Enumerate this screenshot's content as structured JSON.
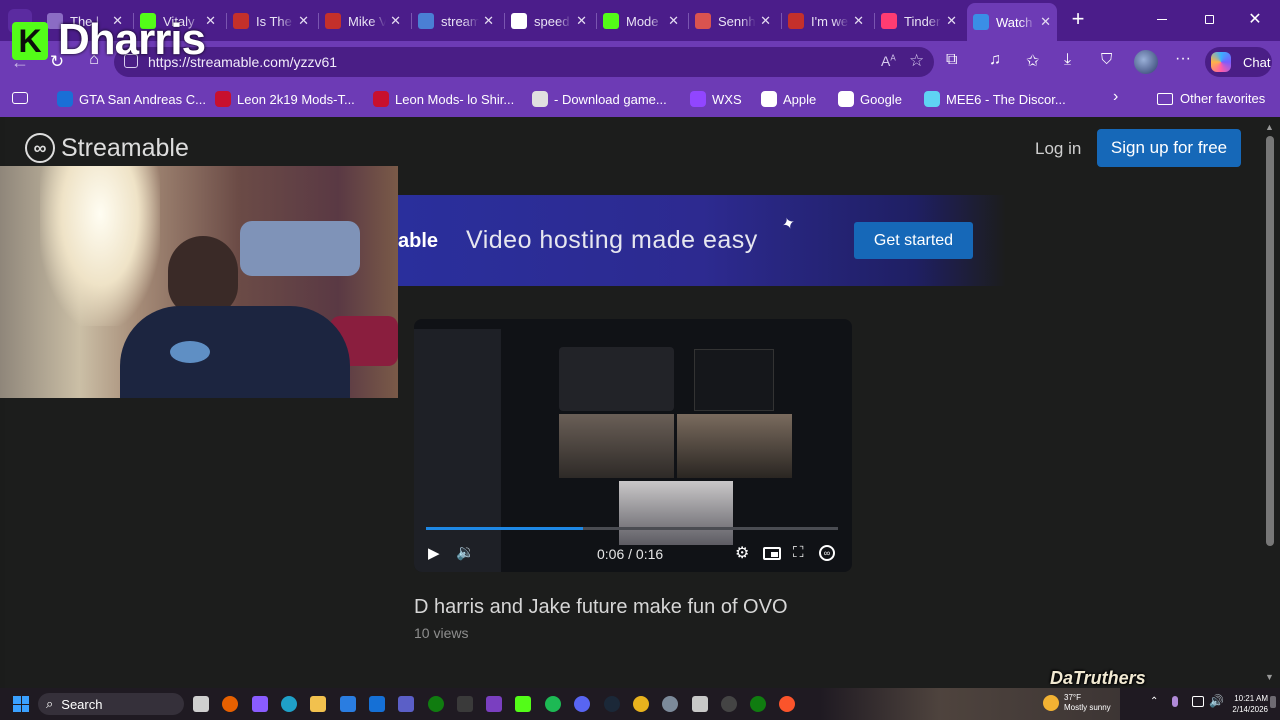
{
  "browser": {
    "tabs": [
      {
        "title": "The l",
        "icon": "globe-icon",
        "color": "#8b6cc4"
      },
      {
        "title": "Vitaly",
        "icon": "kick-icon",
        "color": "#53fc18"
      },
      {
        "title": "Is The",
        "icon": "youtube-icon",
        "color": "#c4302b"
      },
      {
        "title": "Mike V",
        "icon": "youtube-icon",
        "color": "#c4302b"
      },
      {
        "title": "stream",
        "icon": "search-icon",
        "color": "#4a7fd4"
      },
      {
        "title": "speed",
        "icon": "google-icon",
        "color": "#ffffff"
      },
      {
        "title": "Mode",
        "icon": "kick-icon",
        "color": "#53fc18"
      },
      {
        "title": "Sennh",
        "icon": "c-logo-icon",
        "color": "#d9534f"
      },
      {
        "title": "I'm we",
        "icon": "youtube-icon",
        "color": "#c4302b"
      },
      {
        "title": "Tinder",
        "icon": "tinder-icon",
        "color": "#fe3c72"
      },
      {
        "title": "Watch",
        "icon": "streamable-icon",
        "color": "#3a8ee6"
      }
    ],
    "url": "https://streamable.com/yzzv61",
    "chat_label": "Chat",
    "bookmarks": [
      {
        "label": "GTA San Andreas C...",
        "icon": "gtm-icon",
        "color": "#1a6fd6"
      },
      {
        "label": "Leon 2k19 Mods-T...",
        "icon": "leon-icon",
        "color": "#c8102e"
      },
      {
        "label": "Leon Mods- lo Shir...",
        "icon": "leon-icon",
        "color": "#c8102e"
      },
      {
        "label": "- Download game...",
        "icon": "wordpress-icon",
        "color": "#e0e0e0"
      },
      {
        "label": "WXS",
        "icon": "twitch-icon",
        "color": "#9146ff"
      },
      {
        "label": "Apple",
        "icon": "apple-icon",
        "color": "#ffffff"
      },
      {
        "label": "Google",
        "icon": "google-icon",
        "color": "#ffffff"
      },
      {
        "label": "MEE6 - The Discor...",
        "icon": "mee6-icon",
        "color": "#5fd3f3"
      }
    ],
    "other_favorites": "Other favorites"
  },
  "overlay": {
    "streamer_name": "Dharris"
  },
  "site": {
    "logo_text": "Streamable",
    "login_label": "Log in",
    "signup_label": "Sign up for free",
    "banner_left_text": "able",
    "banner_text": "Video hosting made easy",
    "banner_cta": "Get started",
    "video": {
      "current_time": "0:06",
      "duration": "0:16",
      "progress": 0.38,
      "title": "D harris and Jake future make fun of OVO",
      "views": "10 views"
    }
  },
  "taskbar": {
    "search_label": "Search",
    "weather_temp": "37°F",
    "weather_desc": "Mostly sunny",
    "time": "10:21 AM",
    "date": "2/14/2026",
    "watermark": "DaTruthers"
  }
}
